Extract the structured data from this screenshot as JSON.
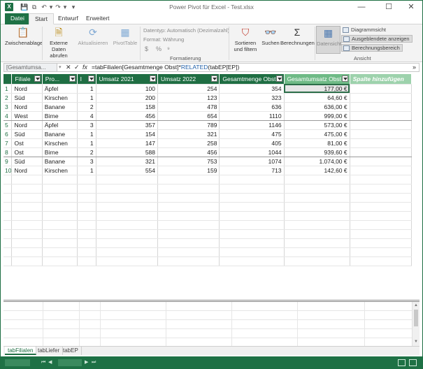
{
  "window": {
    "title": "Power Pivot für Excel - Test.xlsx",
    "app_icon_glyph": "X",
    "controls": {
      "minimize": "—",
      "maximize": "☐",
      "close": "✕"
    },
    "quick_access": {
      "save": "💾",
      "copy": "⧉",
      "undo": "↶",
      "redo": "↷",
      "customize": "▾"
    }
  },
  "tabs": [
    {
      "label": "Datei"
    },
    {
      "label": "Start"
    },
    {
      "label": "Entwurf"
    },
    {
      "label": "Erweitert"
    }
  ],
  "ribbon": {
    "clipboard": "Zwischenablage",
    "external_data_line1": "Externe Daten",
    "external_data_line2": "abrufen",
    "refresh": "Aktualisieren",
    "pivottable": "PivotTable",
    "datatype": "Datentyp: Automatisch (Dezimalzahl)",
    "format": "Format: Währung",
    "currency_symbol": "$",
    "percent_symbol": "%",
    "thousands_symbol": "⁹",
    "group_formatting": "Formatierung",
    "sort_filter_line1": "Sortieren",
    "sort_filter_line2": "und filtern",
    "find": "Suchen",
    "calculations": "Berechnungen",
    "data_view": "Datensicht",
    "diagram_view": "Diagrammsicht",
    "show_hidden": "Ausgeblendete anzeigen",
    "calc_area": "Berechnungsbereich",
    "group_view": "Ansicht"
  },
  "formula_bar": {
    "name_box": "[Gesamtumsa...",
    "cancel": "✕",
    "confirm": "✓",
    "fx": "fx",
    "formula_part1": "=tabFilialen[Gesamtmenge Obst]*",
    "formula_related": "RELATED",
    "formula_part2": "(tabEP[EP])",
    "expand": "»"
  },
  "table": {
    "columns": [
      {
        "label": "Filiale"
      },
      {
        "label": "Pro..."
      },
      {
        "label": "I"
      },
      {
        "label": "Umsatz 2021"
      },
      {
        "label": "Umsatz 2022"
      },
      {
        "label": "Gesamtmenge Obst"
      },
      {
        "label": "Gesamtumsatz Obst"
      },
      {
        "label": "Spalte hinzufügen"
      }
    ],
    "rows": [
      {
        "n": "1",
        "filiale": "Nord",
        "produkt": "Äpfel",
        "i": "1",
        "u21": "100",
        "u22": "254",
        "menge": "354",
        "umsatz": "177,00 €"
      },
      {
        "n": "2",
        "filiale": "Süd",
        "produkt": "Kirschen",
        "i": "1",
        "u21": "200",
        "u22": "123",
        "menge": "323",
        "umsatz": "64,60 €"
      },
      {
        "n": "3",
        "filiale": "Nord",
        "produkt": "Banane",
        "i": "2",
        "u21": "158",
        "u22": "478",
        "menge": "636",
        "umsatz": "636,00 €"
      },
      {
        "n": "4",
        "filiale": "West",
        "produkt": "Birne",
        "i": "4",
        "u21": "456",
        "u22": "654",
        "menge": "1110",
        "umsatz": "999,00 €"
      },
      {
        "n": "5",
        "filiale": "Nord",
        "produkt": "Äpfel",
        "i": "3",
        "u21": "357",
        "u22": "789",
        "menge": "1146",
        "umsatz": "573,00 €"
      },
      {
        "n": "6",
        "filiale": "Süd",
        "produkt": "Banane",
        "i": "1",
        "u21": "154",
        "u22": "321",
        "menge": "475",
        "umsatz": "475,00 €"
      },
      {
        "n": "7",
        "filiale": "Ost",
        "produkt": "Kirschen",
        "i": "1",
        "u21": "147",
        "u22": "258",
        "menge": "405",
        "umsatz": "81,00 €"
      },
      {
        "n": "8",
        "filiale": "Ost",
        "produkt": "Birne",
        "i": "2",
        "u21": "588",
        "u22": "456",
        "menge": "1044",
        "umsatz": "939,60 €"
      },
      {
        "n": "9",
        "filiale": "Süd",
        "produkt": "Banane",
        "i": "3",
        "u21": "321",
        "u22": "753",
        "menge": "1074",
        "umsatz": "1.074,00 €"
      },
      {
        "n": "10",
        "filiale": "Nord",
        "produkt": "Kirschen",
        "i": "1",
        "u21": "554",
        "u22": "159",
        "menge": "713",
        "umsatz": "142,60 €"
      }
    ]
  },
  "sheets": [
    {
      "label": "tabFilialen"
    },
    {
      "label": "tabLiefer"
    },
    {
      "label": "tabEP"
    }
  ],
  "colors": {
    "accent": "#1e7145",
    "header_bg": "#1f6e43",
    "calc_header_bg": "#6fba86",
    "add_col_bg": "#9dd2ac"
  }
}
